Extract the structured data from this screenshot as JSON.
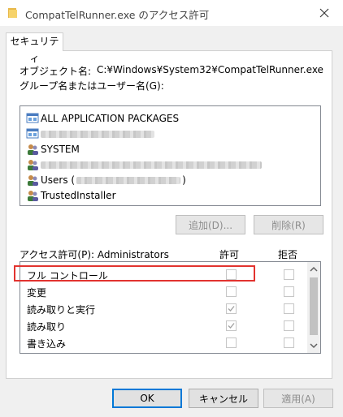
{
  "window": {
    "title": "CompatTelRunner.exe のアクセス許可",
    "close_icon": "close-icon"
  },
  "tab": {
    "label": "セキュリティ"
  },
  "object": {
    "label": "オブジェクト名:",
    "value": "C:¥Windows¥System32¥CompatTelRunner.exe"
  },
  "groups_label": "グループ名またはユーザー名(G):",
  "users": [
    {
      "label": "ALL APPLICATION PACKAGES",
      "icon": "app-packages-icon"
    },
    {
      "label": "",
      "icon": "app-packages-icon"
    },
    {
      "label": "SYSTEM",
      "icon": "users-icon"
    },
    {
      "label": "",
      "icon": "users-icon"
    },
    {
      "label": "Users (",
      "suffix": ")",
      "icon": "users-icon"
    },
    {
      "label": "TrustedInstaller",
      "icon": "users-icon"
    }
  ],
  "buttons": {
    "add": "追加(D)...",
    "remove": "削除(R)"
  },
  "permissions": {
    "header_label": "アクセス許可(P): Administrators",
    "allow_header": "許可",
    "deny_header": "拒否",
    "rows": [
      {
        "name": "フル コントロール",
        "allow": false,
        "deny": false
      },
      {
        "name": "変更",
        "allow": false,
        "deny": false
      },
      {
        "name": "読み取りと実行",
        "allow": true,
        "deny": false
      },
      {
        "name": "読み取り",
        "allow": true,
        "deny": false
      },
      {
        "name": "書き込み",
        "allow": false,
        "deny": false
      }
    ]
  },
  "footer": {
    "ok": "OK",
    "cancel": "キャンセル",
    "apply": "適用(A)"
  },
  "colors": {
    "highlight": "#e2332f",
    "folder": "#e8b84a"
  }
}
